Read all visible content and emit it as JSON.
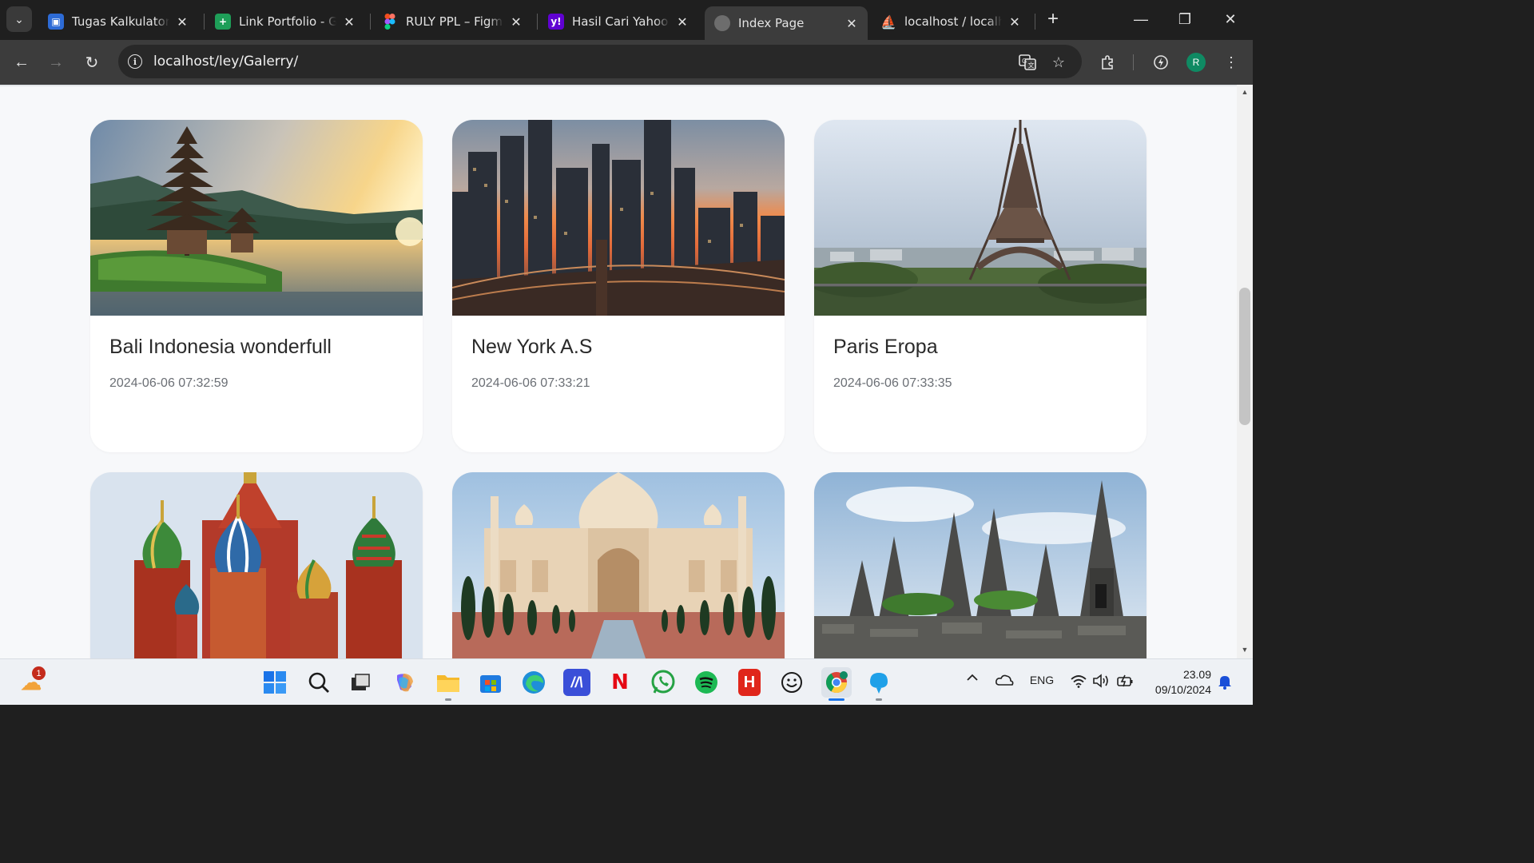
{
  "browser": {
    "tabs": [
      {
        "title": "Tugas Kalkulator S",
        "favicon": "google-classroom-icon",
        "color": "#2d6bd6",
        "glyph": "▣"
      },
      {
        "title": "Link Portfolio - Go",
        "favicon": "google-sheets-icon",
        "color": "#1e9e58",
        "glyph": "+"
      },
      {
        "title": "RULY PPL – Figma",
        "favicon": "figma-icon",
        "color": "#f24e1e",
        "glyph": "◆"
      },
      {
        "title": "Hasil Cari Yahoo u",
        "favicon": "yahoo-icon",
        "color": "#6001d2",
        "glyph": "y!"
      },
      {
        "title": "Index Page",
        "favicon": "globe-icon",
        "color": "#6d6d6d",
        "glyph": "◍"
      },
      {
        "title": "localhost / localho",
        "favicon": "phpmyadmin-icon",
        "color": "#e48a1b",
        "glyph": "⛵"
      }
    ],
    "active_tab_index": 4,
    "url": "localhost/ley/Galerry/",
    "profile_initial": "R"
  },
  "gallery": {
    "cards": [
      {
        "title": "Bali Indonesia wonderfull",
        "date": "2024-06-06 07:32:59",
        "photo": "bali-temple-photo"
      },
      {
        "title": "New York A.S",
        "date": "2024-06-06 07:33:21",
        "photo": "new-york-skyline-photo"
      },
      {
        "title": "Paris Eropa",
        "date": "2024-06-06 07:33:35",
        "photo": "eiffel-tower-photo"
      },
      {
        "title": "",
        "date": "",
        "photo": "moscow-cathedral-photo"
      },
      {
        "title": "",
        "date": "",
        "photo": "taj-mahal-photo"
      },
      {
        "title": "",
        "date": "",
        "photo": "prambanan-temple-photo"
      }
    ]
  },
  "taskbar": {
    "weather_badge": "1",
    "language": "ENG",
    "time": "23.09",
    "date": "09/10/2024",
    "apps": [
      "start-icon",
      "search-icon",
      "task-view-icon",
      "copilot-icon",
      "file-explorer-icon",
      "microsoft-store-icon",
      "edge-icon",
      "code-editor-icon",
      "netflix-icon",
      "whatsapp-icon",
      "spotify-icon",
      "h-app-icon",
      "emoji-icon",
      "chrome-icon",
      "pin-app-icon"
    ]
  }
}
